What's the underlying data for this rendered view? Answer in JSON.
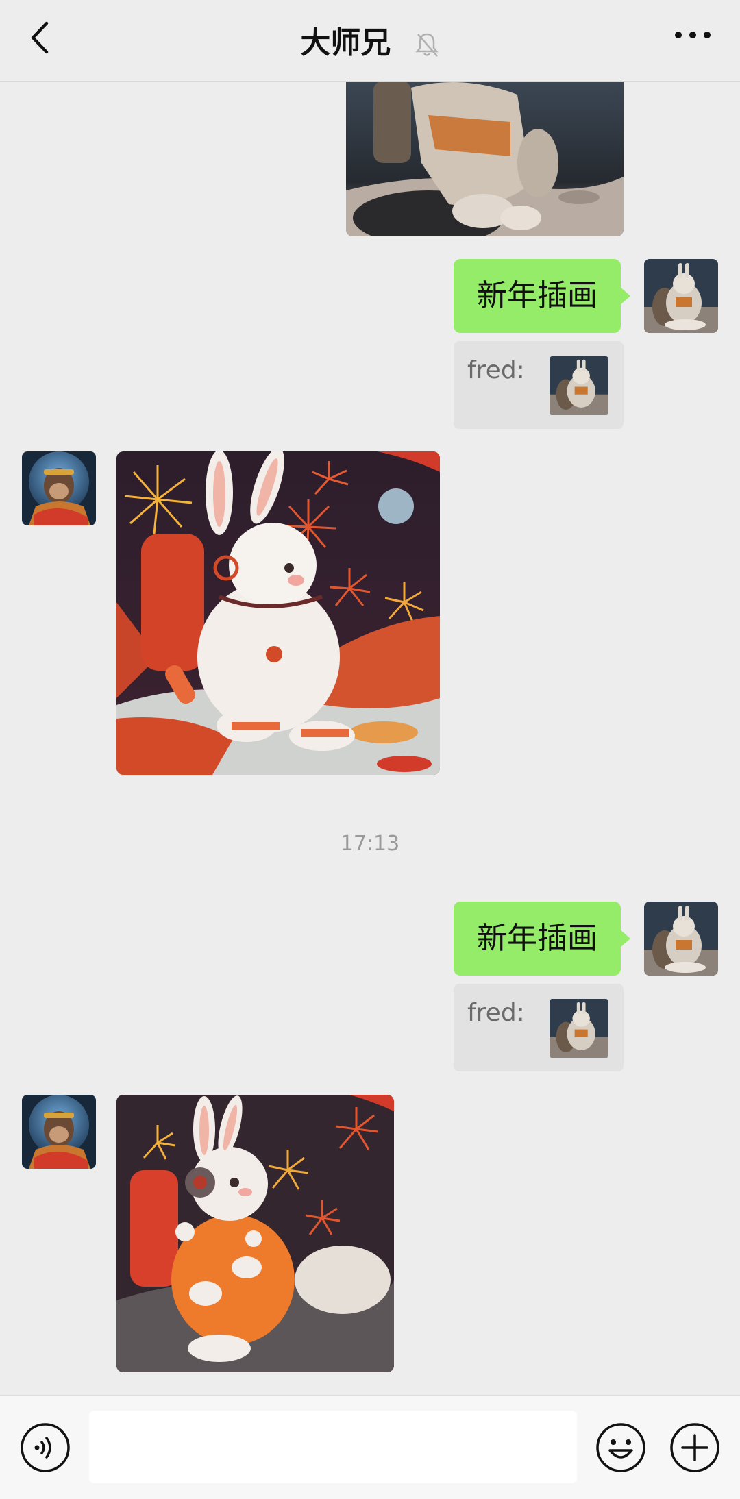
{
  "header": {
    "title": "大师兄",
    "back_icon": "chevron-left-icon",
    "mute_icon": "bell-off-icon",
    "more_icon": "more-dots-icon"
  },
  "messages": {
    "group1": {
      "text": "新年插画",
      "quote_name": "fred:"
    },
    "timestamp": "17:13",
    "group2": {
      "text": "新年插画",
      "quote_name": "fred:"
    }
  },
  "input_bar": {
    "voice_icon": "voice-icon",
    "input_value": "",
    "emoji_icon": "emoji-icon",
    "plus_icon": "plus-icon"
  },
  "colors": {
    "background": "#ededed",
    "my_bubble": "#95ec69",
    "quote_bg": "#e2e2e2"
  }
}
